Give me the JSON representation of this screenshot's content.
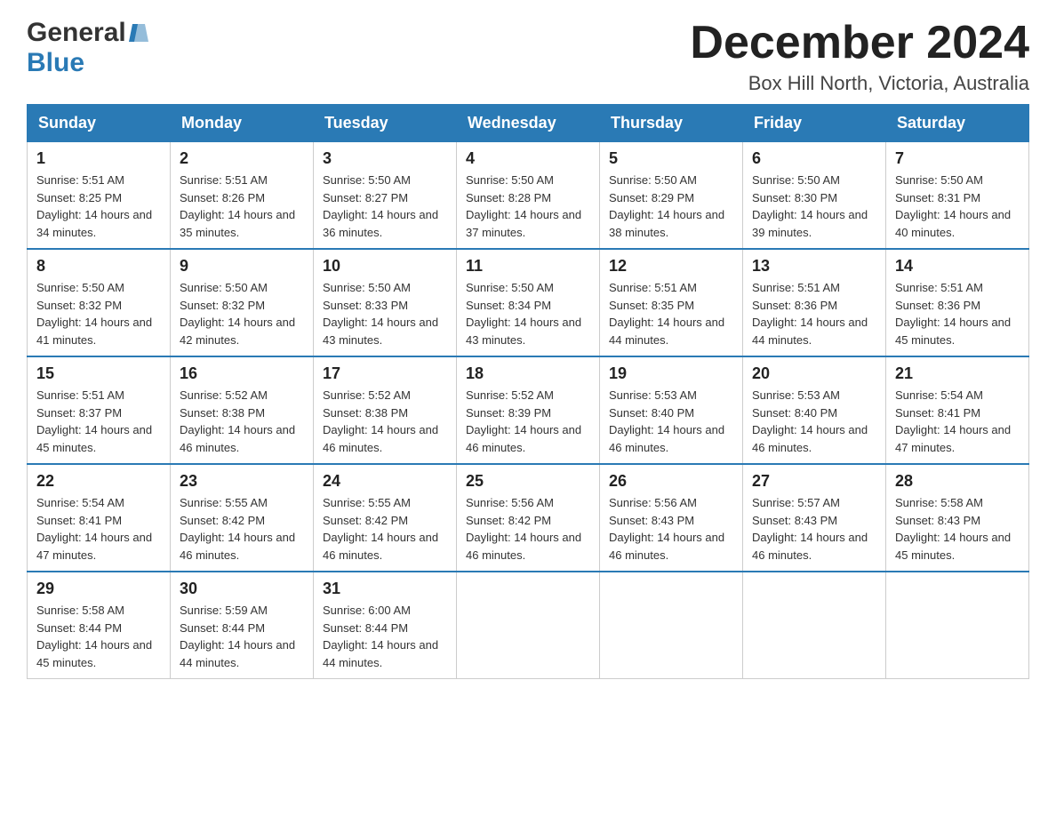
{
  "header": {
    "logo_general": "General",
    "logo_blue": "Blue",
    "month_title": "December 2024",
    "location": "Box Hill North, Victoria, Australia"
  },
  "days_of_week": [
    "Sunday",
    "Monday",
    "Tuesday",
    "Wednesday",
    "Thursday",
    "Friday",
    "Saturday"
  ],
  "weeks": [
    [
      {
        "day": "1",
        "sunrise": "5:51 AM",
        "sunset": "8:25 PM",
        "daylight": "14 hours and 34 minutes."
      },
      {
        "day": "2",
        "sunrise": "5:51 AM",
        "sunset": "8:26 PM",
        "daylight": "14 hours and 35 minutes."
      },
      {
        "day": "3",
        "sunrise": "5:50 AM",
        "sunset": "8:27 PM",
        "daylight": "14 hours and 36 minutes."
      },
      {
        "day": "4",
        "sunrise": "5:50 AM",
        "sunset": "8:28 PM",
        "daylight": "14 hours and 37 minutes."
      },
      {
        "day": "5",
        "sunrise": "5:50 AM",
        "sunset": "8:29 PM",
        "daylight": "14 hours and 38 minutes."
      },
      {
        "day": "6",
        "sunrise": "5:50 AM",
        "sunset": "8:30 PM",
        "daylight": "14 hours and 39 minutes."
      },
      {
        "day": "7",
        "sunrise": "5:50 AM",
        "sunset": "8:31 PM",
        "daylight": "14 hours and 40 minutes."
      }
    ],
    [
      {
        "day": "8",
        "sunrise": "5:50 AM",
        "sunset": "8:32 PM",
        "daylight": "14 hours and 41 minutes."
      },
      {
        "day": "9",
        "sunrise": "5:50 AM",
        "sunset": "8:32 PM",
        "daylight": "14 hours and 42 minutes."
      },
      {
        "day": "10",
        "sunrise": "5:50 AM",
        "sunset": "8:33 PM",
        "daylight": "14 hours and 43 minutes."
      },
      {
        "day": "11",
        "sunrise": "5:50 AM",
        "sunset": "8:34 PM",
        "daylight": "14 hours and 43 minutes."
      },
      {
        "day": "12",
        "sunrise": "5:51 AM",
        "sunset": "8:35 PM",
        "daylight": "14 hours and 44 minutes."
      },
      {
        "day": "13",
        "sunrise": "5:51 AM",
        "sunset": "8:36 PM",
        "daylight": "14 hours and 44 minutes."
      },
      {
        "day": "14",
        "sunrise": "5:51 AM",
        "sunset": "8:36 PM",
        "daylight": "14 hours and 45 minutes."
      }
    ],
    [
      {
        "day": "15",
        "sunrise": "5:51 AM",
        "sunset": "8:37 PM",
        "daylight": "14 hours and 45 minutes."
      },
      {
        "day": "16",
        "sunrise": "5:52 AM",
        "sunset": "8:38 PM",
        "daylight": "14 hours and 46 minutes."
      },
      {
        "day": "17",
        "sunrise": "5:52 AM",
        "sunset": "8:38 PM",
        "daylight": "14 hours and 46 minutes."
      },
      {
        "day": "18",
        "sunrise": "5:52 AM",
        "sunset": "8:39 PM",
        "daylight": "14 hours and 46 minutes."
      },
      {
        "day": "19",
        "sunrise": "5:53 AM",
        "sunset": "8:40 PM",
        "daylight": "14 hours and 46 minutes."
      },
      {
        "day": "20",
        "sunrise": "5:53 AM",
        "sunset": "8:40 PM",
        "daylight": "14 hours and 46 minutes."
      },
      {
        "day": "21",
        "sunrise": "5:54 AM",
        "sunset": "8:41 PM",
        "daylight": "14 hours and 47 minutes."
      }
    ],
    [
      {
        "day": "22",
        "sunrise": "5:54 AM",
        "sunset": "8:41 PM",
        "daylight": "14 hours and 47 minutes."
      },
      {
        "day": "23",
        "sunrise": "5:55 AM",
        "sunset": "8:42 PM",
        "daylight": "14 hours and 46 minutes."
      },
      {
        "day": "24",
        "sunrise": "5:55 AM",
        "sunset": "8:42 PM",
        "daylight": "14 hours and 46 minutes."
      },
      {
        "day": "25",
        "sunrise": "5:56 AM",
        "sunset": "8:42 PM",
        "daylight": "14 hours and 46 minutes."
      },
      {
        "day": "26",
        "sunrise": "5:56 AM",
        "sunset": "8:43 PM",
        "daylight": "14 hours and 46 minutes."
      },
      {
        "day": "27",
        "sunrise": "5:57 AM",
        "sunset": "8:43 PM",
        "daylight": "14 hours and 46 minutes."
      },
      {
        "day": "28",
        "sunrise": "5:58 AM",
        "sunset": "8:43 PM",
        "daylight": "14 hours and 45 minutes."
      }
    ],
    [
      {
        "day": "29",
        "sunrise": "5:58 AM",
        "sunset": "8:44 PM",
        "daylight": "14 hours and 45 minutes."
      },
      {
        "day": "30",
        "sunrise": "5:59 AM",
        "sunset": "8:44 PM",
        "daylight": "14 hours and 44 minutes."
      },
      {
        "day": "31",
        "sunrise": "6:00 AM",
        "sunset": "8:44 PM",
        "daylight": "14 hours and 44 minutes."
      },
      null,
      null,
      null,
      null
    ]
  ]
}
